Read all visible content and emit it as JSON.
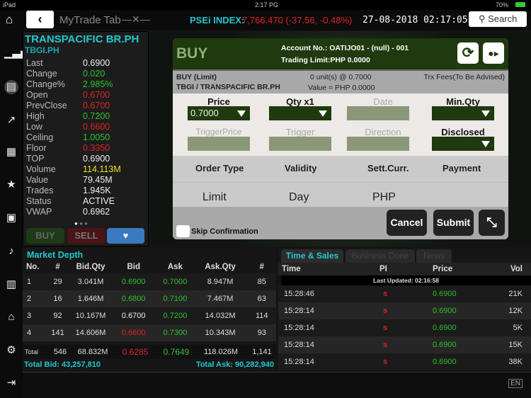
{
  "status_bar": {
    "device": "iPad",
    "time": "2:17 PG",
    "battery": "70%"
  },
  "top_bar": {
    "title": "MyTrade Tab",
    "index_label": "PSEi INDEX:",
    "index_value": "7,766.470 (-37.56, -0.48%)",
    "datetime": "27-08-2018 02:17:05",
    "search_label": "Search"
  },
  "sidebar": {
    "icons": [
      "home-icon",
      "bar-chart-icon",
      "stock-info-icon",
      "chart-up-icon",
      "news-icon",
      "favorite-doc-icon",
      "portfolio-icon",
      "alert-bell-icon",
      "calculator-icon",
      "bank-icon",
      "settings-gear-icon",
      "logout-icon"
    ]
  },
  "stock": {
    "name": "TRANSPACIFIC BR.PH",
    "code": "TBGI.PH",
    "fields": [
      {
        "label": "Last",
        "value": "0.6900",
        "color": "#eeeeee"
      },
      {
        "label": "Change",
        "value": "0.020",
        "color": "#2ec02e"
      },
      {
        "label": "Change%",
        "value": "2.985%",
        "color": "#2ec02e"
      },
      {
        "label": "Open",
        "value": "0.6700",
        "color": "#dd2222"
      },
      {
        "label": "PrevClose",
        "value": "0.6700",
        "color": "#dd2222"
      },
      {
        "label": "High",
        "value": "0.7200",
        "color": "#2ec02e"
      },
      {
        "label": "Low",
        "value": "0.6600",
        "color": "#dd2222"
      },
      {
        "label": "Ceiling",
        "value": "1.0050",
        "color": "#2ec02e"
      },
      {
        "label": "Floor",
        "value": "0.3350",
        "color": "#dd2222"
      },
      {
        "label": "TOP",
        "value": "0.6900",
        "color": "#eeeeee"
      },
      {
        "label": "Volume",
        "value": "114.113M",
        "color": "#e6e020"
      },
      {
        "label": "Value",
        "value": "79.45M",
        "color": "#eeeeee"
      },
      {
        "label": "Trades",
        "value": "1.945K",
        "color": "#eeeeee"
      },
      {
        "label": "Status",
        "value": "ACTIVE",
        "color": "#eeeeee"
      },
      {
        "label": "VWAP",
        "value": "0.6962",
        "color": "#eeeeee"
      }
    ],
    "buy_label": "BUY",
    "sell_label": "SELL"
  },
  "order": {
    "side": "BUY",
    "account": "Account No.: OATIJO01 - (null) - 001",
    "trading_limit": "Trading Limit:PHP 0.0000",
    "summary_type": "BUY (Limit)",
    "summary_stock": "TBGI / TRANSPACIFIC BR.PH",
    "summary_units": "0 unit(s) @ 0.7000",
    "summary_value": "Value = PHP 0.0000",
    "fees": "Trx Fees(To Be Advised)",
    "price_label": "Price",
    "price_value": "0.7000",
    "qty_label": "Qty x1",
    "date_label": "Date",
    "minqty_label": "Min.Qty",
    "triggerprice_label": "TriggerPrice",
    "trigger_label": "Trigger",
    "direction_label": "Direction",
    "disclosed_label": "Disclosed",
    "ordertype_label": "Order Type",
    "validity_label": "Validity",
    "settcurr_label": "Sett.Curr.",
    "payment_label": "Payment",
    "ordertype_value": "Limit",
    "validity_value": "Day",
    "settcurr_value": "PHP",
    "skip_label": "Skip Confirmation",
    "cancel_label": "Cancel",
    "submit_label": "Submit"
  },
  "depth": {
    "title": "Market Depth",
    "headers": [
      "No.",
      "#",
      "Bid.Qty",
      "Bid",
      "Ask",
      "Ask.Qty",
      "#"
    ],
    "rows": [
      {
        "no": "1",
        "bn": "29",
        "bq": "3.041M",
        "bid": "0.6900",
        "bc": "g",
        "ask": "0.7000",
        "ac": "g",
        "aq": "8.947M",
        "an": "85"
      },
      {
        "no": "2",
        "bn": "16",
        "bq": "1.646M",
        "bid": "0.6800",
        "bc": "g",
        "ask": "0.7100",
        "ac": "g",
        "aq": "7.467M",
        "an": "63"
      },
      {
        "no": "3",
        "bn": "92",
        "bq": "10.167M",
        "bid": "0.6700",
        "bc": "w",
        "ask": "0.7200",
        "ac": "g",
        "aq": "14.032M",
        "an": "114"
      },
      {
        "no": "4",
        "bn": "141",
        "bq": "14.606M",
        "bid": "0.6600",
        "bc": "r",
        "ask": "0.7300",
        "ac": "g",
        "aq": "10.343M",
        "an": "93"
      }
    ],
    "total": {
      "label": "Total",
      "bn": "546",
      "bq": "68.832M",
      "bid": "0.6285",
      "ask": "0.7649",
      "aq": "118.026M",
      "an": "1,141"
    },
    "total_bid": "Total Bid: 43,257,810",
    "total_ask": "Total Ask: 90,282,940"
  },
  "time_sales": {
    "tabs": [
      "Time & Sales",
      "Business Done",
      "News"
    ],
    "headers": [
      "Time",
      "PI",
      "Price",
      "Vol"
    ],
    "last_updated": "Last Updated: 02:16:58",
    "rows": [
      {
        "time": "15:28:46",
        "pi": "s",
        "price": "0.6900",
        "vol": "21K"
      },
      {
        "time": "15:28:14",
        "pi": "s",
        "price": "0.6900",
        "vol": "12K"
      },
      {
        "time": "15:28:14",
        "pi": "s",
        "price": "0.6900",
        "vol": "5K"
      },
      {
        "time": "15:28:14",
        "pi": "s",
        "price": "0.6900",
        "vol": "15K"
      },
      {
        "time": "15:28:14",
        "pi": "s",
        "price": "0.6900",
        "vol": "38K"
      }
    ]
  },
  "bottom": {
    "lang": "EN"
  }
}
